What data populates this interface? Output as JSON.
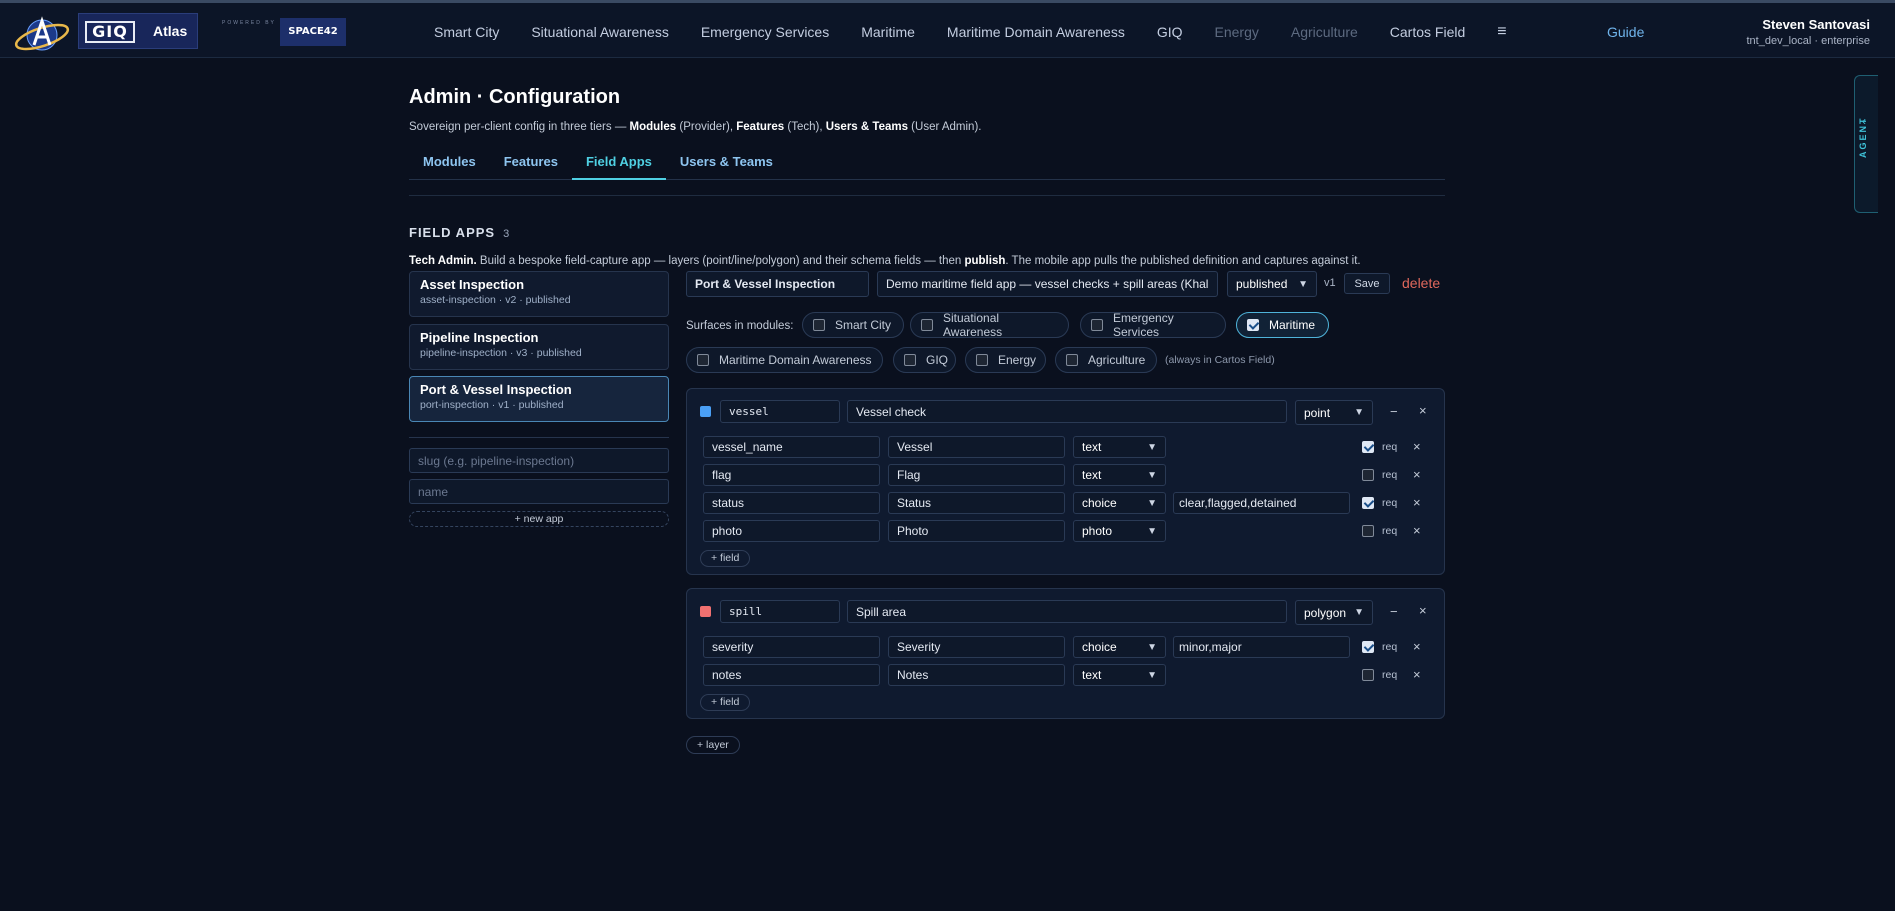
{
  "header": {
    "brand": "GIQ",
    "app_name": "Atlas",
    "powered_by": "POWERED BY",
    "partner": "SPACE42",
    "nav": [
      {
        "label": "Smart City",
        "dim": false
      },
      {
        "label": "Situational Awareness",
        "dim": false
      },
      {
        "label": "Emergency Services",
        "dim": false
      },
      {
        "label": "Maritime",
        "dim": false
      },
      {
        "label": "Maritime Domain Awareness",
        "dim": false
      },
      {
        "label": "GIQ",
        "dim": false
      },
      {
        "label": "Energy",
        "dim": true
      },
      {
        "label": "Agriculture",
        "dim": true
      },
      {
        "label": "Cartos Field",
        "dim": false
      }
    ],
    "menu_glyph": "≡",
    "guide": "Guide",
    "user_name": "Steven Santovasi",
    "user_org": "tnt_dev_local · enterprise"
  },
  "agent": {
    "label": "AGENT",
    "chev": "‹"
  },
  "page": {
    "title": "Admin · Configuration",
    "subtitle_pre": "Sovereign per-client config in three tiers — ",
    "subtitle_b1": "Modules",
    "subtitle_m1": " (Provider), ",
    "subtitle_b2": "Features",
    "subtitle_m2": " (Tech), ",
    "subtitle_b3": "Users & Teams",
    "subtitle_post": " (User Admin).",
    "tabs": [
      "Modules",
      "Features",
      "Field Apps",
      "Users & Teams"
    ],
    "active_tab": "Field Apps"
  },
  "section": {
    "title": "FIELD APPS",
    "count": "3",
    "desc_b1": "Tech Admin.",
    "desc_mid": " Build a bespoke field-capture app — layers (point/line/polygon) and their schema fields — then ",
    "desc_b2": "publish",
    "desc_post": ". The mobile app pulls the published definition and captures against it."
  },
  "apps": [
    {
      "name": "Asset Inspection",
      "meta": "asset-inspection · v2 · published"
    },
    {
      "name": "Pipeline Inspection",
      "meta": "pipeline-inspection · v3 · published"
    },
    {
      "name": "Port & Vessel Inspection",
      "meta": "port-inspection · v1 · published"
    }
  ],
  "new_app": {
    "slug_placeholder": "slug (e.g. pipeline-inspection)",
    "name_placeholder": "name",
    "button": "+ new app"
  },
  "editor": {
    "app_name": "Port & Vessel Inspection",
    "description": "Demo maritime field app — vessel checks + spill areas (Khal",
    "status": "published",
    "version": "v1",
    "save": "Save",
    "delete": "delete",
    "surfaces_label": "Surfaces in modules:",
    "surfaces": [
      {
        "label": "Smart City",
        "on": false
      },
      {
        "label": "Situational Awareness",
        "on": false
      },
      {
        "label": "Emergency Services",
        "on": false
      },
      {
        "label": "Maritime",
        "on": true
      },
      {
        "label": "Maritime Domain Awareness",
        "on": false
      },
      {
        "label": "GIQ",
        "on": false
      },
      {
        "label": "Energy",
        "on": false
      },
      {
        "label": "Agriculture",
        "on": false
      }
    ],
    "always_note": "(always in Cartos Field)",
    "req_label": "req",
    "add_field": "+ field",
    "add_layer": "+ layer",
    "layers": [
      {
        "key": "vessel",
        "title": "Vessel check",
        "geometry": "point",
        "color": "#4a9ff5",
        "fields": [
          {
            "key": "vessel_name",
            "label": "Vessel",
            "type": "text",
            "options": "",
            "req": true
          },
          {
            "key": "flag",
            "label": "Flag",
            "type": "text",
            "options": "",
            "req": false
          },
          {
            "key": "status",
            "label": "Status",
            "type": "choice",
            "options": "clear,flagged,detained",
            "req": true
          },
          {
            "key": "photo",
            "label": "Photo",
            "type": "photo",
            "options": "",
            "req": false
          }
        ]
      },
      {
        "key": "spill",
        "title": "Spill area",
        "geometry": "polygon",
        "color": "#f07070",
        "fields": [
          {
            "key": "severity",
            "label": "Severity",
            "type": "choice",
            "options": "minor,major",
            "req": true
          },
          {
            "key": "notes",
            "label": "Notes",
            "type": "text",
            "options": "",
            "req": false
          }
        ]
      }
    ]
  }
}
